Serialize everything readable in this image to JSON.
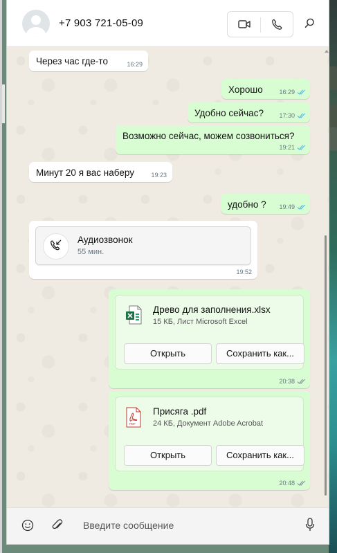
{
  "header": {
    "contact_phone": "+7 903 721-05-09",
    "video_call_icon": "video-camera-icon",
    "voice_call_icon": "phone-icon",
    "search_icon": "search-icon"
  },
  "messages": [
    {
      "dir": "in",
      "text": "Через час где-то",
      "time": "16:29"
    },
    {
      "dir": "out",
      "text": "Хорошо",
      "time": "16:29",
      "status": "read"
    },
    {
      "dir": "out",
      "text": "Удобно сейчас?",
      "time": "17:30",
      "status": "read"
    },
    {
      "dir": "out",
      "text": "Возможно сейчас, можем созвониться?",
      "time": "19:21",
      "status": "read"
    },
    {
      "dir": "in",
      "text": "Минут 20 я вас наберу",
      "time": "19:23"
    },
    {
      "dir": "out",
      "text": "удобно ?",
      "time": "19:49",
      "status": "read"
    }
  ],
  "call": {
    "title": "Аудиозвонок",
    "duration": "55 мин.",
    "time": "19:52",
    "icon": "incoming-call-icon"
  },
  "files": [
    {
      "name": "Древо для заполнения.xlsx",
      "meta": "15 КБ, Лист Microsoft Excel",
      "icon": "excel-file-icon",
      "open_label": "Открыть",
      "save_label": "Сохранить как...",
      "time": "20:38",
      "status": "delivered"
    },
    {
      "name": "Присяга .pdf",
      "meta": "24 КБ, Документ Adobe Acrobat",
      "icon": "pdf-file-icon",
      "open_label": "Открыть",
      "save_label": "Сохранить как...",
      "time": "20:48",
      "status": "delivered"
    }
  ],
  "composer": {
    "placeholder": "Введите сообщение",
    "emoji_icon": "emoji-icon",
    "attach_icon": "paperclip-icon",
    "mic_icon": "microphone-icon"
  },
  "colors": {
    "incoming_bubble": "#ffffff",
    "outgoing_bubble": "#d9fdd3",
    "read_ticks": "#53bdeb",
    "chat_background": "#efeae2"
  }
}
